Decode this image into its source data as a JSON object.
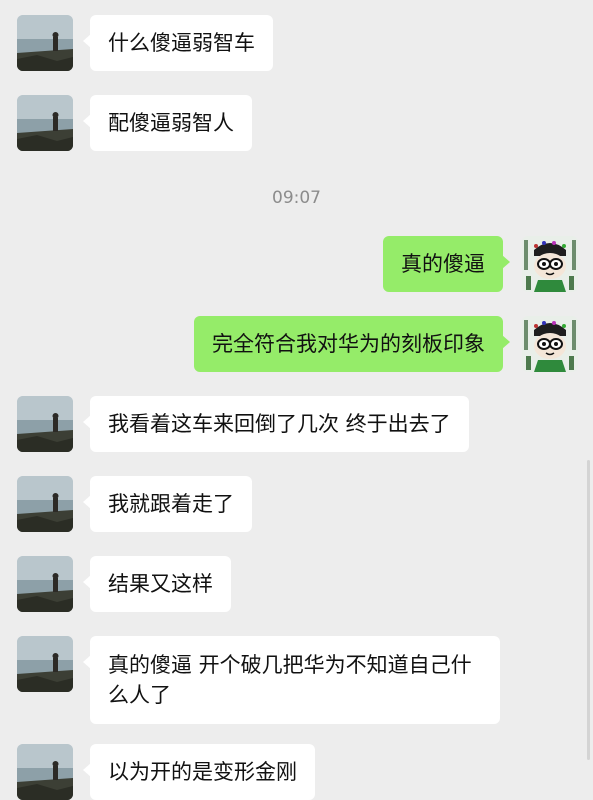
{
  "chat": {
    "timestamp": "09:07",
    "messages": [
      {
        "side": "in",
        "text": "什么傻逼弱智车"
      },
      {
        "side": "in",
        "text": "配傻逼弱智人"
      },
      {
        "side": "out",
        "text": "真的傻逼"
      },
      {
        "side": "out",
        "text": "完全符合我对华为的刻板印象"
      },
      {
        "side": "in",
        "text": "我看着这车来回倒了几次 终于出去了"
      },
      {
        "side": "in",
        "text": "我就跟着走了"
      },
      {
        "side": "in",
        "text": "结果又这样"
      },
      {
        "side": "in",
        "text": "真的傻逼 开个破几把华为不知道自己什么人了"
      },
      {
        "side": "in",
        "text": "以为开的是变形金刚"
      }
    ]
  },
  "colors": {
    "background": "#ededed",
    "incoming_bubble": "#ffffff",
    "outgoing_bubble": "#95ec69"
  },
  "icons": {
    "contact_avatar": "landscape-photo-avatar",
    "my_avatar": "cartoon-character-avatar"
  }
}
